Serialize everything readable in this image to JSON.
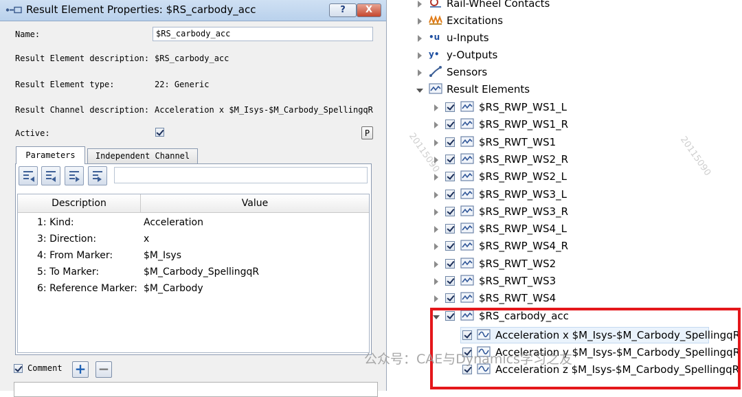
{
  "dialog": {
    "title": "Result Element Properties: $RS_carbody_acc",
    "help_label": "?",
    "close_label": "X",
    "fields": {
      "name_label": "Name:",
      "name_value": "$RS_carbody_acc",
      "description_label": "Result Element description:",
      "description_value": "$RS_carbody_acc",
      "type_label": "Result Element type:",
      "type_value": "22: Generic",
      "channel_label": "Result Channel description:",
      "channel_value": "Acceleration x $M_Isys-$M_Carbody_SpellingqR",
      "active_label": "Active:",
      "active_checked": true,
      "p_label": "P"
    },
    "tabs": [
      {
        "label": "Parameters",
        "active": true
      },
      {
        "label": "Independent Channel",
        "active": false
      }
    ],
    "grid": {
      "columns": [
        "Description",
        "Value"
      ],
      "rows": [
        {
          "desc": "1: Kind:",
          "value": "Acceleration"
        },
        {
          "desc": "3: Direction:",
          "value": "x"
        },
        {
          "desc": "4: From Marker:",
          "value": "$M_Isys"
        },
        {
          "desc": "5: To Marker:",
          "value": "$M_Carbody_SpellingqR"
        },
        {
          "desc": "6: Reference Marker:",
          "value": "$M_Carbody"
        }
      ]
    },
    "comment": {
      "label": "Comment",
      "checked": true,
      "add_label": "+",
      "remove_label": "−"
    }
  },
  "tree": {
    "items": [
      {
        "label": "Rail-Wheel Contacts",
        "icon": "rail-wheel-icon"
      },
      {
        "label": "Excitations",
        "icon": "excitations-icon"
      },
      {
        "label": "u-Inputs",
        "icon": "u-inputs-icon",
        "prefix": "•u"
      },
      {
        "label": "y-Outputs",
        "icon": "y-outputs-icon",
        "prefix": "y•"
      },
      {
        "label": "Sensors",
        "icon": "sensors-icon"
      },
      {
        "label": "Result Elements",
        "icon": "result-elements-icon"
      }
    ],
    "results": [
      "$RS_RWP_WS1_L",
      "$RS_RWP_WS1_R",
      "$RS_RWT_WS1",
      "$RS_RWP_WS2_R",
      "$RS_RWP_WS2_L",
      "$RS_RWP_WS3_L",
      "$RS_RWP_WS3_R",
      "$RS_RWP_WS4_L",
      "$RS_RWP_WS4_R",
      "$RS_RWT_WS2",
      "$RS_RWT_WS3",
      "$RS_RWT_WS4",
      "$RS_carbody_acc"
    ],
    "channels": [
      "Acceleration x $M_Isys-$M_Carbody_SpellingqR",
      "Acceleration y $M_Isys-$M_Carbody_SpellingqR",
      "Acceleration z $M_Isys-$M_Carbody_SpellingqR"
    ]
  },
  "watermarks": {
    "id_text": "20115090",
    "wechat_text": "公众号：CAE与Dynamics学习之友"
  },
  "colors": {
    "highlight": "#e4171b",
    "selection": "#eaf3fc"
  }
}
